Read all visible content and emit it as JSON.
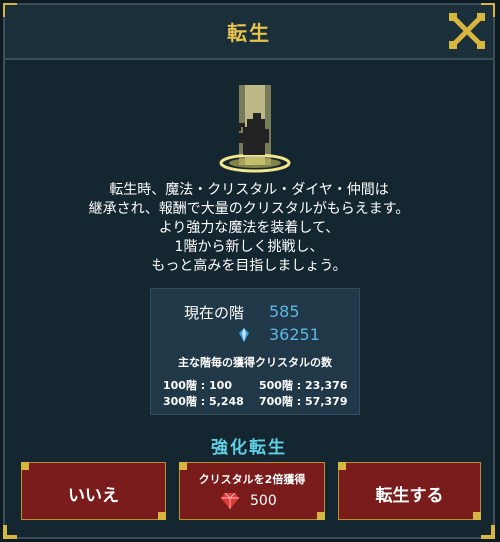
{
  "dialog": {
    "title": "転生",
    "description_lines": [
      "転生時、魔法・クリスタル・ダイヤ・仲間は",
      "継承され、報酬で大量のクリスタルがもらえます。",
      "より強力な魔法を装着して、",
      "1階から新しく挑戦し、",
      "もっと高みを目指しましょう。"
    ]
  },
  "stats": {
    "floor_label": "現在の階",
    "floor_value": "585",
    "crystal_value": "36251",
    "subheading": "主な階毎の獲得クリスタルの数",
    "rewards": [
      "100階 : 100",
      "500階 : 23,376",
      "300階 : 5,248",
      "700階 : 57,379"
    ]
  },
  "enhance_label": "強化転生",
  "buttons": {
    "no": "いいえ",
    "double_crystal": "クリスタルを2倍獲得",
    "double_cost": "500",
    "reincarnate": "転生する"
  },
  "colors": {
    "accent_gold": "#e6c34a",
    "value_blue": "#5fb6e6",
    "enhance_cyan": "#5fd0e6",
    "button_red": "#7a1c1c"
  },
  "icons": {
    "close": "close-x-icon",
    "crystal": "crystal-icon",
    "diamond": "ruby-gem-icon"
  }
}
